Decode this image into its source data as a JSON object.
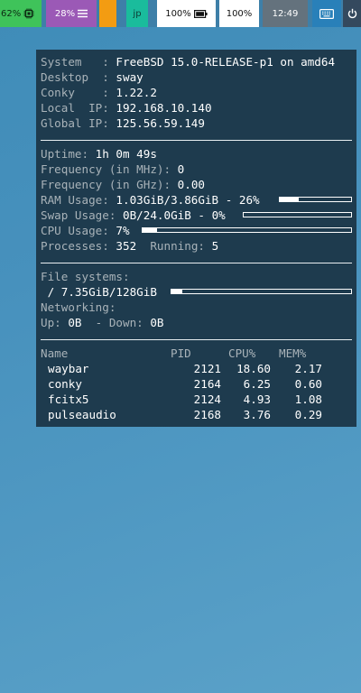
{
  "topbar": {
    "cpu": {
      "value": "62%",
      "icon": "cpu-chip-icon"
    },
    "memory": {
      "value": "28%",
      "icon": "hamburger-menu-icon"
    },
    "language": "jp",
    "battery": {
      "value": "100%",
      "icon": "battery-icon"
    },
    "volume": "100%",
    "clock": "12:49",
    "keyboard_icon": "keyboard-icon",
    "power_icon": "power-icon",
    "colors": {
      "cpu": "#3fc35a",
      "memory": "#9b59b6",
      "orange": "#f39c12",
      "language": "#1abc9c",
      "battery": "#ffffff",
      "clock": "#64727d",
      "keyboard": "#2980b9",
      "power": "#34495e"
    }
  },
  "conky": {
    "background": "#1e3b4e",
    "info": [
      {
        "label": "System   : ",
        "value": "FreeBSD 15.0-RELEASE-p1 on amd64"
      },
      {
        "label": "Desktop  : ",
        "value": "sway"
      },
      {
        "label": "Conky    : ",
        "value": "1.22.2"
      },
      {
        "label": "Local  IP: ",
        "value": "192.168.10.140"
      },
      {
        "label": "Global IP: ",
        "value": "125.56.59.149"
      }
    ],
    "uptime": {
      "label": "Uptime: ",
      "value": "1h 0m 49s"
    },
    "freq_mhz": {
      "label": "Frequency (in MHz): ",
      "value": "0"
    },
    "freq_ghz": {
      "label": "Frequency (in GHz): ",
      "value": "0.00"
    },
    "ram": {
      "label": "RAM Usage: ",
      "value": "1.03GiB/3.86GiB - 26%",
      "percent": 26
    },
    "swap": {
      "label": "Swap Usage: ",
      "value": "0B/24.0GiB - 0%",
      "percent": 0
    },
    "cpu": {
      "label": "CPU Usage: ",
      "value": "7%",
      "percent": 7
    },
    "processes": {
      "label": "Processes: ",
      "value": "352",
      "running_label": "  Running: ",
      "running_value": "5"
    },
    "filesystems": {
      "heading": "File systems:",
      "mount": " / ",
      "value": "7.35GiB/128GiB",
      "percent": 6
    },
    "networking": {
      "heading": "Networking:",
      "up_label": "Up: ",
      "up_value": "0B",
      "down_label": "  - Down: ",
      "down_value": "0B"
    },
    "process_table": {
      "headers": [
        "Name",
        "PID",
        "CPU%",
        "MEM%"
      ],
      "rows": [
        [
          "waybar",
          "2121",
          "18.60",
          "2.17"
        ],
        [
          "conky",
          "2164",
          "6.25",
          "0.60"
        ],
        [
          "fcitx5",
          "2124",
          "4.93",
          "1.08"
        ],
        [
          "pulseaudio",
          "2168",
          "3.76",
          "0.29"
        ]
      ]
    }
  }
}
